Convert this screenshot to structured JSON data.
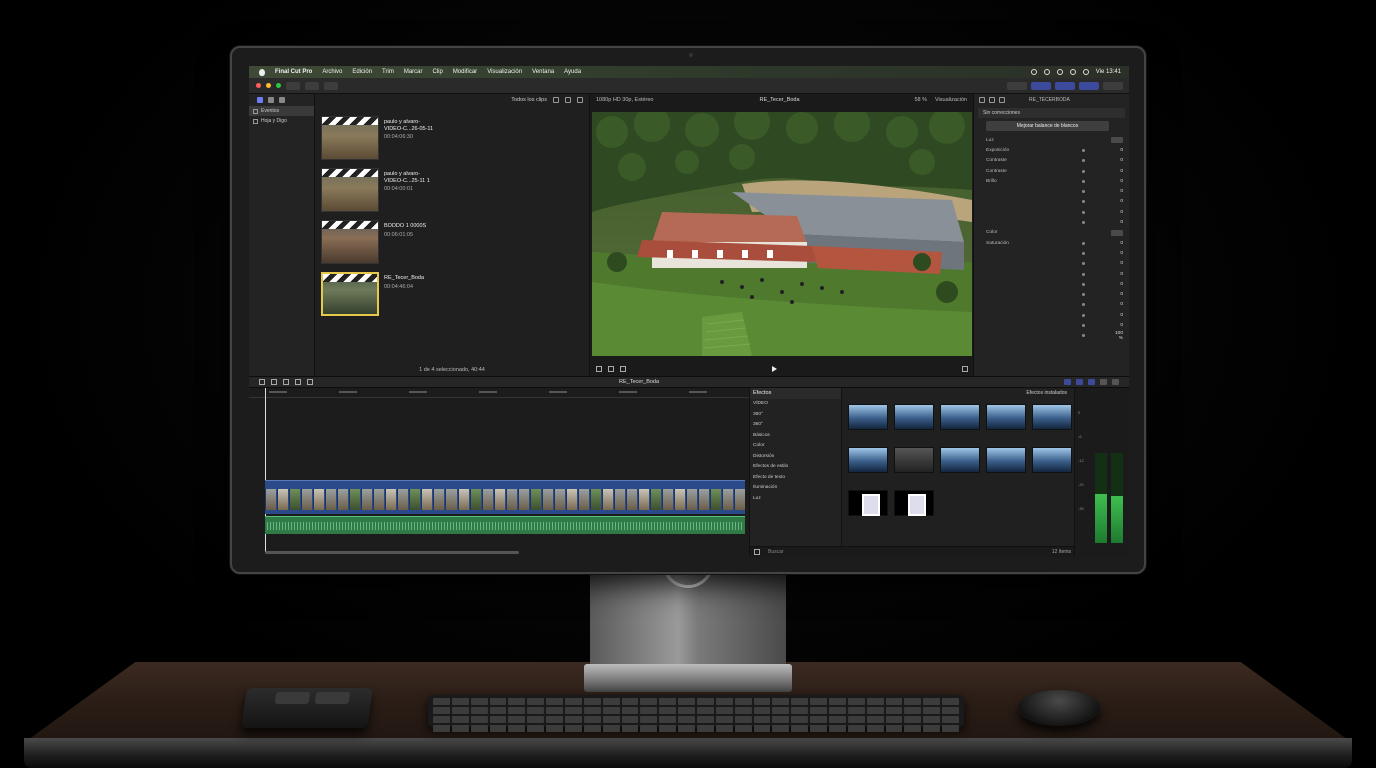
{
  "menubar": {
    "app_name": "Final Cut Pro",
    "items": [
      "Archivo",
      "Edición",
      "Trim",
      "Marcar",
      "Clip",
      "Modificar",
      "Visualización",
      "Ventana",
      "Ayuda"
    ],
    "clock": "Vie 13:41"
  },
  "libraries": {
    "items": [
      "Eventos",
      "Hoja y Digo"
    ]
  },
  "browser": {
    "filter_label": "Todos los clips",
    "clips": [
      {
        "title": "paulo y alvaro-",
        "name": "VIDEO-C...26-05-11",
        "line3": "",
        "duration": "00:04:06:30"
      },
      {
        "title": "paulo y alvaro-",
        "name": "VIDEO-C...25-11 1",
        "line3": "",
        "duration": "00:04:00:01"
      },
      {
        "title": "BODDO 1 0000S",
        "name": "",
        "line3": "",
        "duration": "00:06:01:05"
      },
      {
        "title": "RE_Tecer_Boda",
        "name": "",
        "line3": "",
        "duration": "00:04:46:04"
      }
    ],
    "footer": "1 de 4 seleccionado, 40:44"
  },
  "viewer": {
    "format": "1080p HD 30p, Estéreo",
    "clip_name": "RE_Tecer_Boda",
    "zoom": "58 %",
    "view_menu": "Visualización"
  },
  "inspector": {
    "title": "RE_TECERBODA",
    "timecode": "",
    "subtitle": "Sin correcciones",
    "button": "Mejorar balance de blancos",
    "rows": [
      {
        "label": "Luz",
        "value": "",
        "section": true
      },
      {
        "label": "Exposición",
        "value": "0"
      },
      {
        "label": "Contraste",
        "value": "0"
      },
      {
        "label": "Contraste",
        "value": "0"
      },
      {
        "label": "Brillo",
        "value": "0"
      },
      {
        "label": "",
        "value": "0"
      },
      {
        "label": "",
        "value": "0"
      },
      {
        "label": "",
        "value": "0"
      },
      {
        "label": "",
        "value": "0"
      },
      {
        "label": "Color",
        "value": "",
        "section": true
      },
      {
        "label": "Saturación",
        "value": "0"
      },
      {
        "label": "",
        "value": "0"
      },
      {
        "label": "",
        "value": "0"
      },
      {
        "label": "",
        "value": "0"
      },
      {
        "label": "",
        "value": "0"
      },
      {
        "label": "",
        "value": "0"
      },
      {
        "label": "",
        "value": "0"
      },
      {
        "label": "",
        "value": "0"
      },
      {
        "label": "",
        "value": "0"
      },
      {
        "label": "",
        "value": "100 %"
      }
    ]
  },
  "timeline": {
    "title": "RE_Tecer_Boda"
  },
  "effects": {
    "header": "Efectos",
    "installed_label": "Efectos instalados",
    "categories": [
      "VÍDEO",
      "360°",
      "360°",
      "Básicos",
      "Color",
      "Distorsión",
      "Efectos de estilo",
      "Efecto de texto",
      "Iluminación",
      "Luz"
    ],
    "active_category": "",
    "items": [
      {
        "label": "",
        "kind": "blue"
      },
      {
        "label": "",
        "kind": "blue"
      },
      {
        "label": "",
        "kind": "blue"
      },
      {
        "label": "",
        "kind": "blue"
      },
      {
        "label": "",
        "kind": "blue"
      },
      {
        "label": "",
        "kind": "blue"
      },
      {
        "label": "",
        "kind": "dark"
      },
      {
        "label": "",
        "kind": "blue"
      },
      {
        "label": "",
        "kind": "blue"
      },
      {
        "label": "",
        "kind": "blue"
      },
      {
        "label": "",
        "kind": "photo"
      },
      {
        "label": "",
        "kind": "photo"
      }
    ],
    "search_placeholder": "Buscar",
    "count": "12 ítems"
  },
  "meters": {
    "scale": [
      "0",
      "-6",
      "-12",
      "-20",
      "-30"
    ],
    "left_level": 0.55,
    "right_level": 0.52
  },
  "colors": {
    "accent": "#6f7df5",
    "selection": "#e6c84a",
    "video_clip": "#2b4a8a",
    "audio_clip": "#2f7a45"
  }
}
